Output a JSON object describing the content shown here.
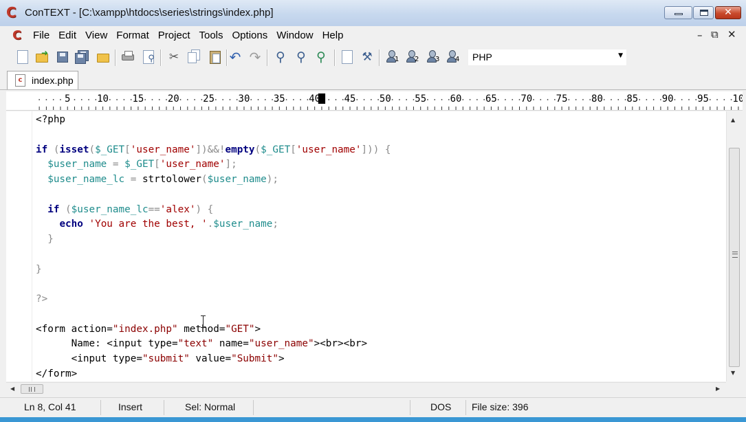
{
  "window": {
    "title": "ConTEXT - [C:\\xampp\\htdocs\\series\\strings\\index.php]",
    "app_logo": "C",
    "controls": {
      "close": "✕"
    }
  },
  "menu": {
    "items": [
      "File",
      "Edit",
      "View",
      "Format",
      "Project",
      "Tools",
      "Options",
      "Window",
      "Help"
    ],
    "mdi_controls": {
      "minimize": "–",
      "restore": "⧉",
      "close": "✕"
    }
  },
  "toolbar": {
    "icons": [
      "new-file-icon",
      "open-file-icon",
      "save-icon",
      "save-all-icon",
      "open-folder-icon",
      "print-icon",
      "print-preview-icon",
      "cut-icon",
      "copy-icon",
      "paste-icon",
      "undo-icon",
      "redo-icon",
      "find-icon",
      "find-next-icon",
      "replace-icon",
      "document-properties-icon",
      "run-icon",
      "user-tool-1-icon",
      "user-tool-2-icon",
      "user-tool-3-icon",
      "user-tool-4-icon"
    ],
    "user_tool_numbers": [
      "1",
      "2",
      "3",
      "4"
    ],
    "language": {
      "value": "PHP",
      "arrow": "▼"
    }
  },
  "tabs": [
    {
      "label": "index.php",
      "icon": "php-file-icon",
      "icon_letter": "c"
    }
  ],
  "ruler": {
    "labels": [
      "5",
      "10",
      "15",
      "20",
      "25",
      "30",
      "35",
      "40",
      "45",
      "50",
      "55",
      "60",
      "65",
      "70",
      "75",
      "80",
      "85",
      "90",
      "95",
      "10"
    ]
  },
  "editor": {
    "cursor_ln": 8,
    "cursor_col": 41
  },
  "scrollbar": {
    "up": "▲",
    "down": "▼",
    "left": "◀",
    "right": "▶"
  },
  "status": {
    "position": "Ln 8, Col 41",
    "mode": "Insert",
    "selection": "Sel: Normal",
    "line_endings": "DOS",
    "file_size": "File size: 396"
  },
  "colors": {
    "keyword": "#00007f",
    "variable": "#1f8c8c",
    "string": "#a00000",
    "title_bar": "#c7d8ee",
    "bottom_strip": "#3a97d4"
  }
}
